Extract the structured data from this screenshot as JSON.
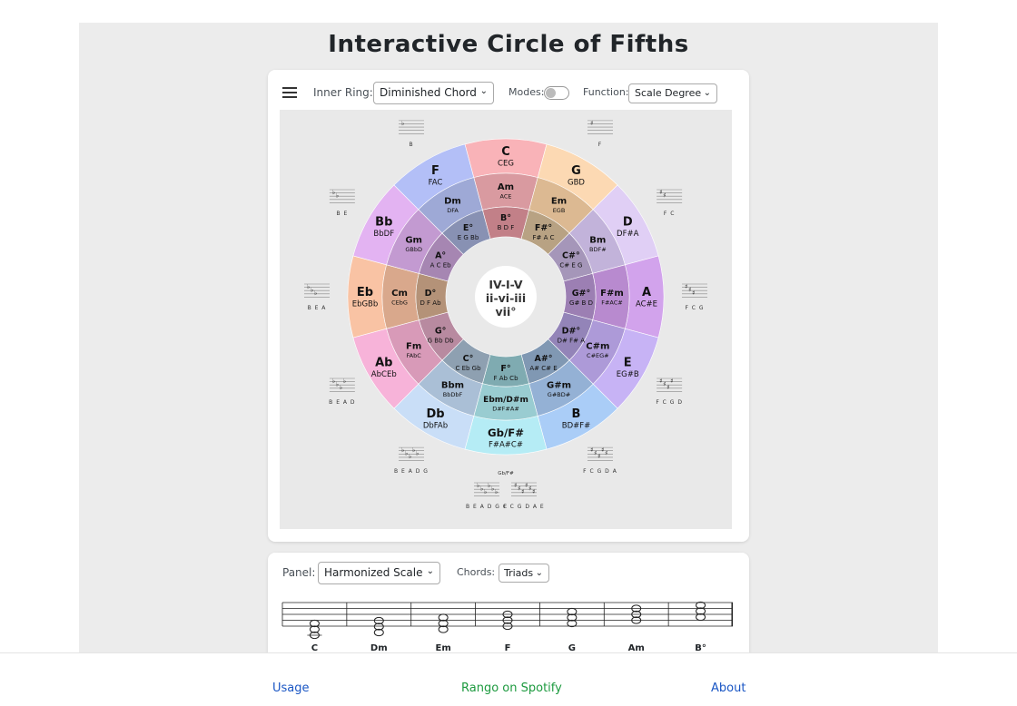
{
  "title": "Interactive Circle of Fifths",
  "toolbar": {
    "inner_ring_label": "Inner Ring:",
    "inner_ring_value": "Diminished Chord",
    "modes_label": "Modes:",
    "function_label": "Function:",
    "function_value": "Scale Degree"
  },
  "center": {
    "line1": "IV-I-V",
    "line2": "ii-vi-iii",
    "line3": "vii°"
  },
  "outer_ring": [
    {
      "name": "C",
      "notes": "CEG",
      "color": "#f9b3b8"
    },
    {
      "name": "G",
      "notes": "GBD",
      "color": "#fcd9b3"
    },
    {
      "name": "D",
      "notes": "DF#A",
      "color": "#e0cff5"
    },
    {
      "name": "A",
      "notes": "AC#E",
      "color": "#d2a3ec"
    },
    {
      "name": "E",
      "notes": "EG#B",
      "color": "#c7b3f5"
    },
    {
      "name": "B",
      "notes": "BD#F#",
      "color": "#aacdf7"
    },
    {
      "name": "Gb/F#",
      "notes": "F#A#C#",
      "color": "#b5ecf5"
    },
    {
      "name": "Db",
      "notes": "DbFAb",
      "color": "#c9def7"
    },
    {
      "name": "Ab",
      "notes": "AbCEb",
      "color": "#f7b3d9"
    },
    {
      "name": "Eb",
      "notes": "EbGBb",
      "color": "#f9c3a4"
    },
    {
      "name": "Bb",
      "notes": "BbDF",
      "color": "#e3b3f2"
    },
    {
      "name": "F",
      "notes": "FAC",
      "color": "#b3bff7"
    }
  ],
  "middle_ring": [
    {
      "name": "Am",
      "notes": "ACE",
      "color": "#d99aa0"
    },
    {
      "name": "Em",
      "notes": "EGB",
      "color": "#dcb992"
    },
    {
      "name": "Bm",
      "notes": "BDF#",
      "color": "#c2b3da"
    },
    {
      "name": "F#m",
      "notes": "F#AC#",
      "color": "#b88acf"
    },
    {
      "name": "C#m",
      "notes": "C#EG#",
      "color": "#ad9ad8"
    },
    {
      "name": "G#m",
      "notes": "G#BD#",
      "color": "#94b1d5"
    },
    {
      "name": "Ebm/D#m",
      "notes": "D#F#A#",
      "color": "#99ccd1"
    },
    {
      "name": "Bbm",
      "notes": "BbDbF",
      "color": "#aabfd6"
    },
    {
      "name": "Fm",
      "notes": "FAbC",
      "color": "#d89ab8"
    },
    {
      "name": "Cm",
      "notes": "CEbG",
      "color": "#d9a88c"
    },
    {
      "name": "Gm",
      "notes": "GBbD",
      "color": "#c39ad1"
    },
    {
      "name": "Dm",
      "notes": "DFA",
      "color": "#9ea9d6"
    }
  ],
  "inner_ring": [
    {
      "name": "B°",
      "notes": "B D F",
      "color": "#c28088"
    },
    {
      "name": "F#°",
      "notes": "F# A C",
      "color": "#b8a283"
    },
    {
      "name": "C#°",
      "notes": "C# E G",
      "color": "#a596b9"
    },
    {
      "name": "G#°",
      "notes": "G# B D",
      "color": "#9c7fb3"
    },
    {
      "name": "D#°",
      "notes": "D# F# A",
      "color": "#9384b8"
    },
    {
      "name": "A#°",
      "notes": "A# C# E",
      "color": "#8098b3"
    },
    {
      "name": "F°",
      "notes": "F Ab Cb",
      "color": "#7fabb1"
    },
    {
      "name": "C°",
      "notes": "C Eb Gb",
      "color": "#8ea0b1"
    },
    {
      "name": "G°",
      "notes": "G Bb Db",
      "color": "#b88aa0"
    },
    {
      "name": "D°",
      "notes": "D F Ab",
      "color": "#b49278"
    },
    {
      "name": "A°",
      "notes": "A C Eb",
      "color": "#a686b2"
    },
    {
      "name": "E°",
      "notes": "E G Bb",
      "color": "#8891b3"
    }
  ],
  "key_signatures": [
    {
      "label": "",
      "symbols": ""
    },
    {
      "label": "F",
      "symbols": "#"
    },
    {
      "label": "F C",
      "symbols": "##"
    },
    {
      "label": "F C G",
      "symbols": "###"
    },
    {
      "label": "F C G D",
      "symbols": "####"
    },
    {
      "label": "F C G D A",
      "symbols": "#####"
    },
    {
      "label": "B E A D G C",
      "label2": "F C G D A E",
      "top": "Gb/F#",
      "symbols": "bbbbbb",
      "symbols2": "######"
    },
    {
      "label": "B E A D G",
      "symbols": "bbbbb"
    },
    {
      "label": "B E A D",
      "symbols": "bbbb"
    },
    {
      "label": "B E A",
      "symbols": "bbb"
    },
    {
      "label": "B E",
      "symbols": "bb"
    },
    {
      "label": "B",
      "symbols": "b"
    }
  ],
  "panel": {
    "panel_label": "Panel:",
    "panel_value": "Harmonized Scale",
    "chords_label": "Chords:",
    "chords_value": "Triads",
    "chords": [
      "C",
      "Dm",
      "Em",
      "F",
      "G",
      "Am",
      "B°"
    ]
  },
  "footer": {
    "usage": "Usage",
    "spotify": "Rango on Spotify",
    "about": "About"
  },
  "colors": {
    "link": "#1a56c4",
    "spotify": "#1d9a3f"
  }
}
